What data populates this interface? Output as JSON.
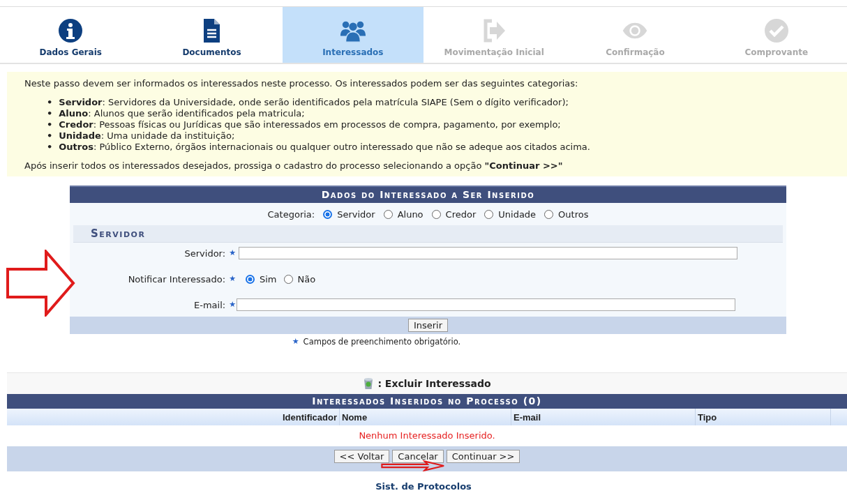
{
  "steps": [
    {
      "label": "Dados Gerais",
      "selected": false,
      "disabled": false
    },
    {
      "label": "Documentos",
      "selected": false,
      "disabled": false
    },
    {
      "label": "Interessados",
      "selected": true,
      "disabled": false
    },
    {
      "label": "Movimentação Inicial",
      "selected": false,
      "disabled": true
    },
    {
      "label": "Confirmação",
      "selected": false,
      "disabled": true
    },
    {
      "label": "Comprovante",
      "selected": false,
      "disabled": true
    }
  ],
  "instructions": {
    "intro": "Neste passo devem ser informados os interessados neste processo. Os interessados podem ser das seguintes categorias:",
    "items": [
      {
        "bullet": "•",
        "text": "**Servidor**: Servidores da Universidade, onde serão identificados pela matrícula SIAPE (Sem o dígito verificador);"
      },
      {
        "bullet": "•",
        "text": "**Aluno**: Alunos que serão identificados pela matricula;"
      },
      {
        "bullet": "•",
        "text": "**Credor**: Pessoas físicas ou Jurídicas que são interessados em processos de compra, pagamento, por exemplo;"
      },
      {
        "bullet": "•",
        "text": "**Unidade**: Uma unidade da instituição;"
      },
      {
        "bullet": "•",
        "text": "**Outros**: Público Externo, órgãos internacionais ou qualquer outro interessado que não se adeque aos citados acima."
      }
    ],
    "outro": "Após inserir todos os interessados desejados, prossiga o cadastro do processo selecionando a opção **\"Continuar >>\"**"
  },
  "form": {
    "title": "Dados do Interessado a Ser Inserido",
    "category_label": "Categoria:",
    "categories": [
      {
        "label": "Servidor",
        "selected": true
      },
      {
        "label": "Aluno",
        "selected": false
      },
      {
        "label": "Credor",
        "selected": false
      },
      {
        "label": "Unidade",
        "selected": false
      },
      {
        "label": "Outros",
        "selected": false
      }
    ],
    "section": "Servidor",
    "servidor_label": "Servidor:",
    "servidor_required": "★",
    "notify_label": "Notificar Interessado:",
    "notify_required": "★",
    "notify_options": [
      {
        "label": "Sim",
        "selected": true
      },
      {
        "label": "Não",
        "selected": false
      }
    ],
    "email_label": "E-mail:",
    "email_required": "★",
    "insert_button": "Inserir",
    "note_mark": "★",
    "required_note": "Campos de preenchimento obrigatório."
  },
  "legend": ": Excluir Interessado",
  "table": {
    "title": "Interessados Inseridos no Processo (0)",
    "columns": [
      "Identificador",
      "Nome",
      "E-mail",
      "Tipo"
    ],
    "empty": "Nenhum Interessado Inserido.",
    "buttons": [
      "<< Voltar",
      "Cancelar",
      "Continuar >>"
    ]
  },
  "footer": "Sist. de Protocolos"
}
